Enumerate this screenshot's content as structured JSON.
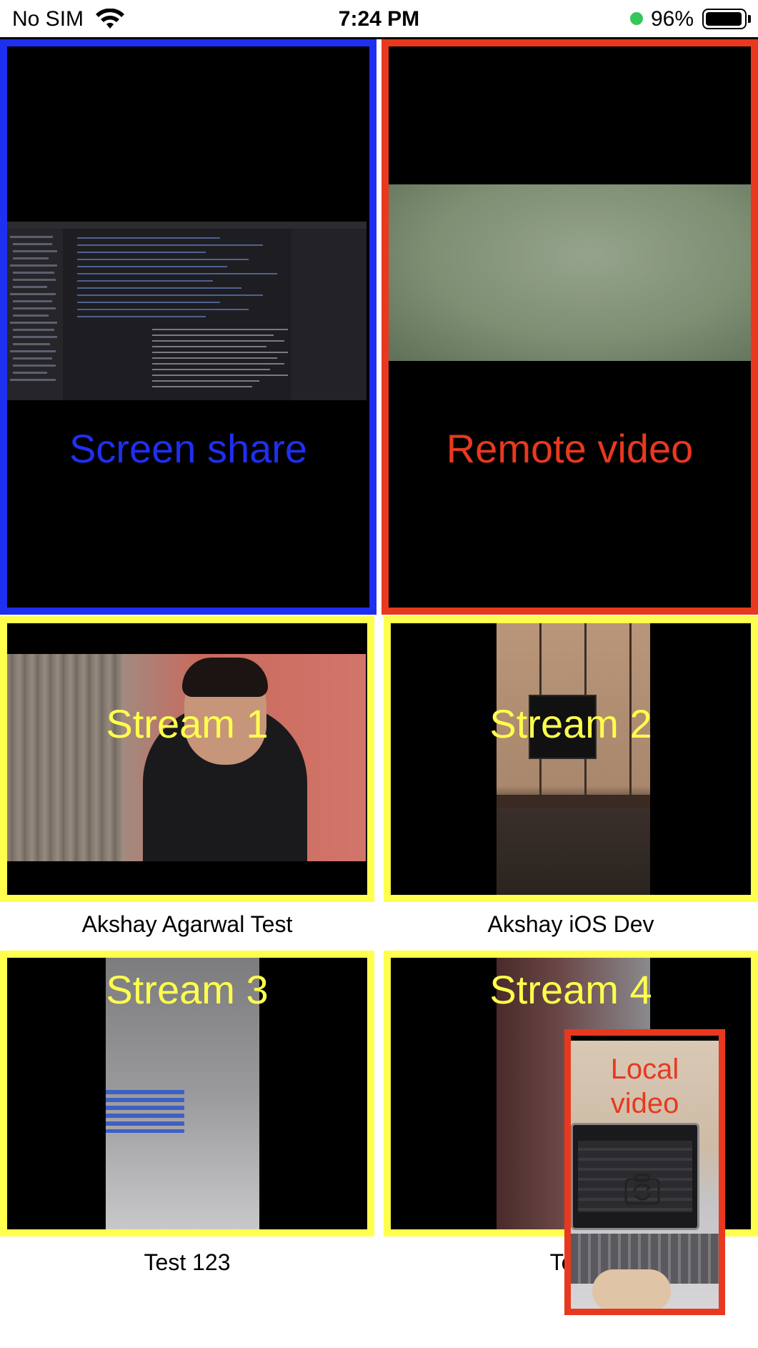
{
  "status_bar": {
    "carrier": "No SIM",
    "time": "7:24 PM",
    "battery_percent": "96%",
    "battery_level": 0.96,
    "icons": [
      "wifi-icon",
      "battery-icon"
    ]
  },
  "tiles": {
    "screen_share": {
      "label": "Screen share",
      "frame_color": "#1f2ff0"
    },
    "remote_video": {
      "label": "Remote video",
      "frame_color": "#e8391f"
    },
    "streams": [
      {
        "label": "Stream 1",
        "name": "Akshay Agarwal Test"
      },
      {
        "label": "Stream 2",
        "name": "Akshay iOS Dev"
      },
      {
        "label": "Stream 3",
        "name": "Test 123"
      },
      {
        "label": "Stream 4",
        "name": "Test"
      }
    ],
    "stream_frame_color": "#ffff4d",
    "local_video": {
      "label_line1": "Local",
      "label_line2": "video",
      "frame_color": "#e8391f"
    }
  }
}
